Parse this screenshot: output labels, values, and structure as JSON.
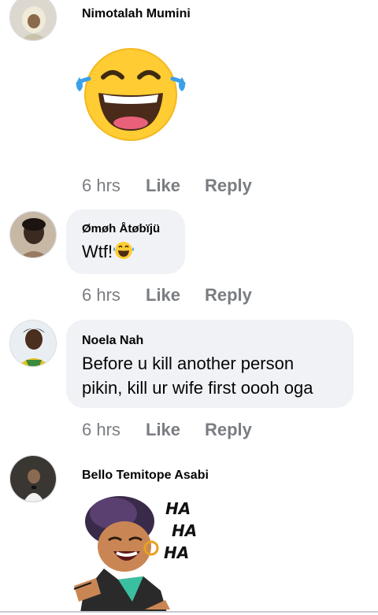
{
  "comments": [
    {
      "author": "Nimotalah Mumini",
      "media": "laughing-tears-emoji",
      "time": "6 hrs",
      "like": "Like",
      "reply": "Reply"
    },
    {
      "author": "Ømøh Åtøbïjü",
      "text": "Wtf!",
      "emoji": "laughing-tears-emoji",
      "time": "6 hrs",
      "like": "Like",
      "reply": "Reply"
    },
    {
      "author": "Noela Nah",
      "text_line1": "Before u kill another person",
      "text_line2": "pikin, kill ur wife first oooh oga",
      "time": "6 hrs",
      "like": "Like",
      "reply": "Reply"
    },
    {
      "author": "Bello Temitope Asabi",
      "media": "laughing-woman-sticker",
      "sticker_text": [
        "HA",
        "HA",
        "HA"
      ]
    }
  ],
  "colors": {
    "bubble": "#f0f2f5",
    "meta_text": "#7a7d82",
    "emoji_yellow": "#ffcc33",
    "tear_blue": "#3aa0e8"
  }
}
